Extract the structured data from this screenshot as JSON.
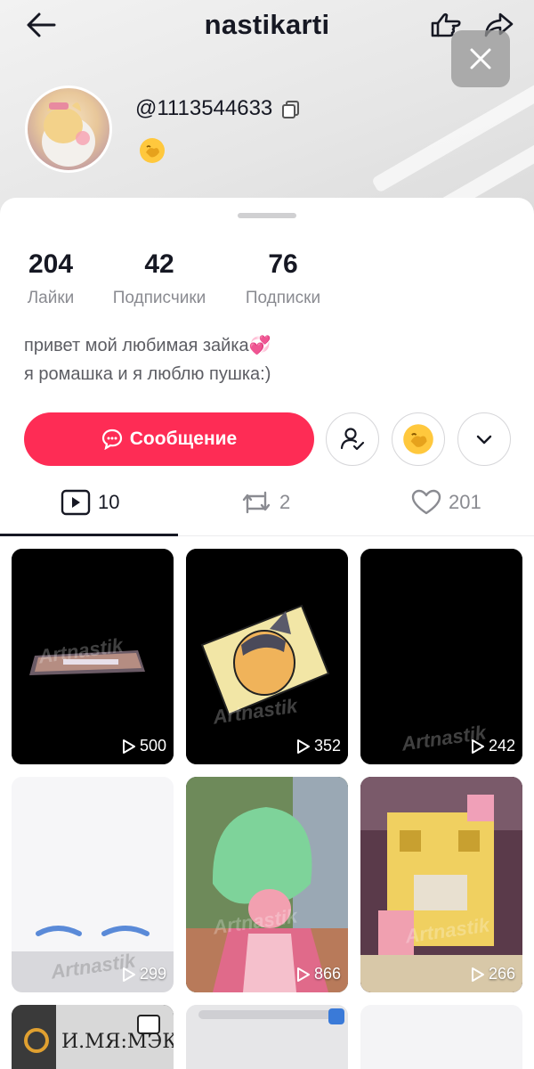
{
  "header": {
    "title": "nastikarti",
    "username": "@1113544633"
  },
  "stats": [
    {
      "value": "204",
      "label": "Лайки"
    },
    {
      "value": "42",
      "label": "Подписчики"
    },
    {
      "value": "76",
      "label": "Подписки"
    }
  ],
  "bio": {
    "line1": "привет мой любимая зайка💞",
    "line2": "я ромашка и я люблю пушка:)"
  },
  "actions": {
    "message_label": "Сообщение"
  },
  "tabs": [
    {
      "icon": "video-icon",
      "count": "10"
    },
    {
      "icon": "repost-icon",
      "count": "2"
    },
    {
      "icon": "heart-icon",
      "count": "201"
    }
  ],
  "videos": [
    {
      "views": "500"
    },
    {
      "views": "352"
    },
    {
      "views": "242"
    },
    {
      "views": "299"
    },
    {
      "views": "866"
    },
    {
      "views": "266"
    }
  ],
  "colors": {
    "accent": "#fe2c55",
    "text": "#161823",
    "muted": "#8a8b91"
  }
}
